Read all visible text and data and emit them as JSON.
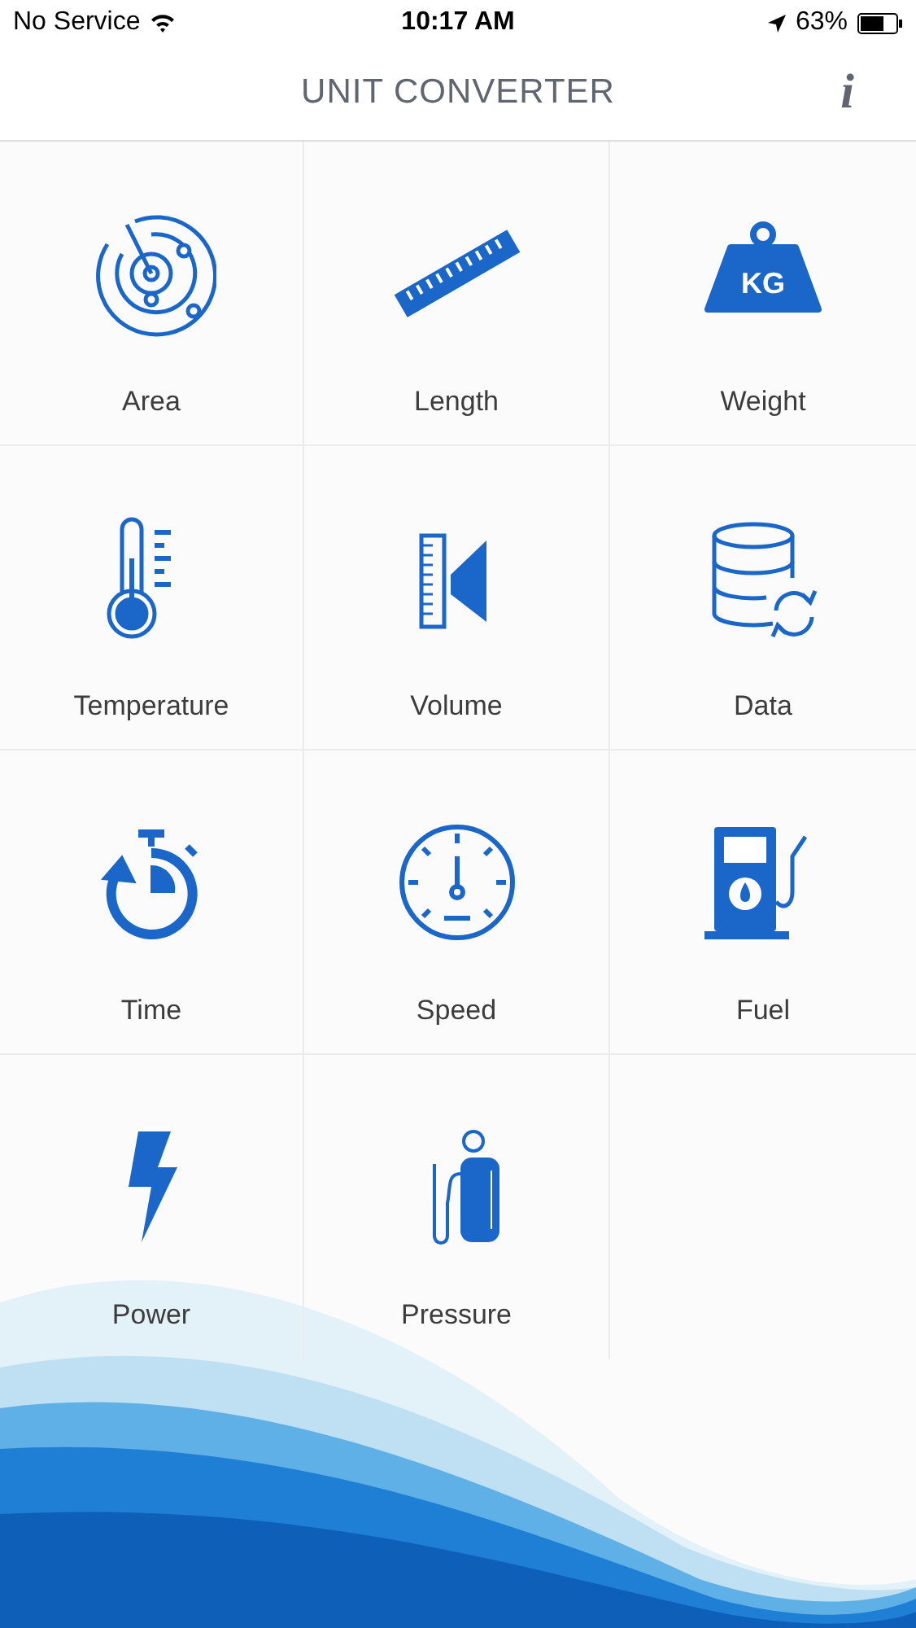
{
  "status_bar": {
    "carrier": "No Service",
    "time": "10:17 AM",
    "battery": "63%"
  },
  "header": {
    "title": "UNIT CONVERTER",
    "info": "i"
  },
  "weight_icon_text": "KG",
  "categories": [
    {
      "label": "Area",
      "kind": "radar"
    },
    {
      "label": "Length",
      "kind": "ruler"
    },
    {
      "label": "Weight",
      "kind": "weight"
    },
    {
      "label": "Temperature",
      "kind": "thermometer"
    },
    {
      "label": "Volume",
      "kind": "speaker"
    },
    {
      "label": "Data",
      "kind": "database"
    },
    {
      "label": "Time",
      "kind": "stopwatch"
    },
    {
      "label": "Speed",
      "kind": "gauge"
    },
    {
      "label": "Fuel",
      "kind": "pump"
    },
    {
      "label": "Power",
      "kind": "bolt"
    },
    {
      "label": "Pressure",
      "kind": "tank"
    }
  ]
}
